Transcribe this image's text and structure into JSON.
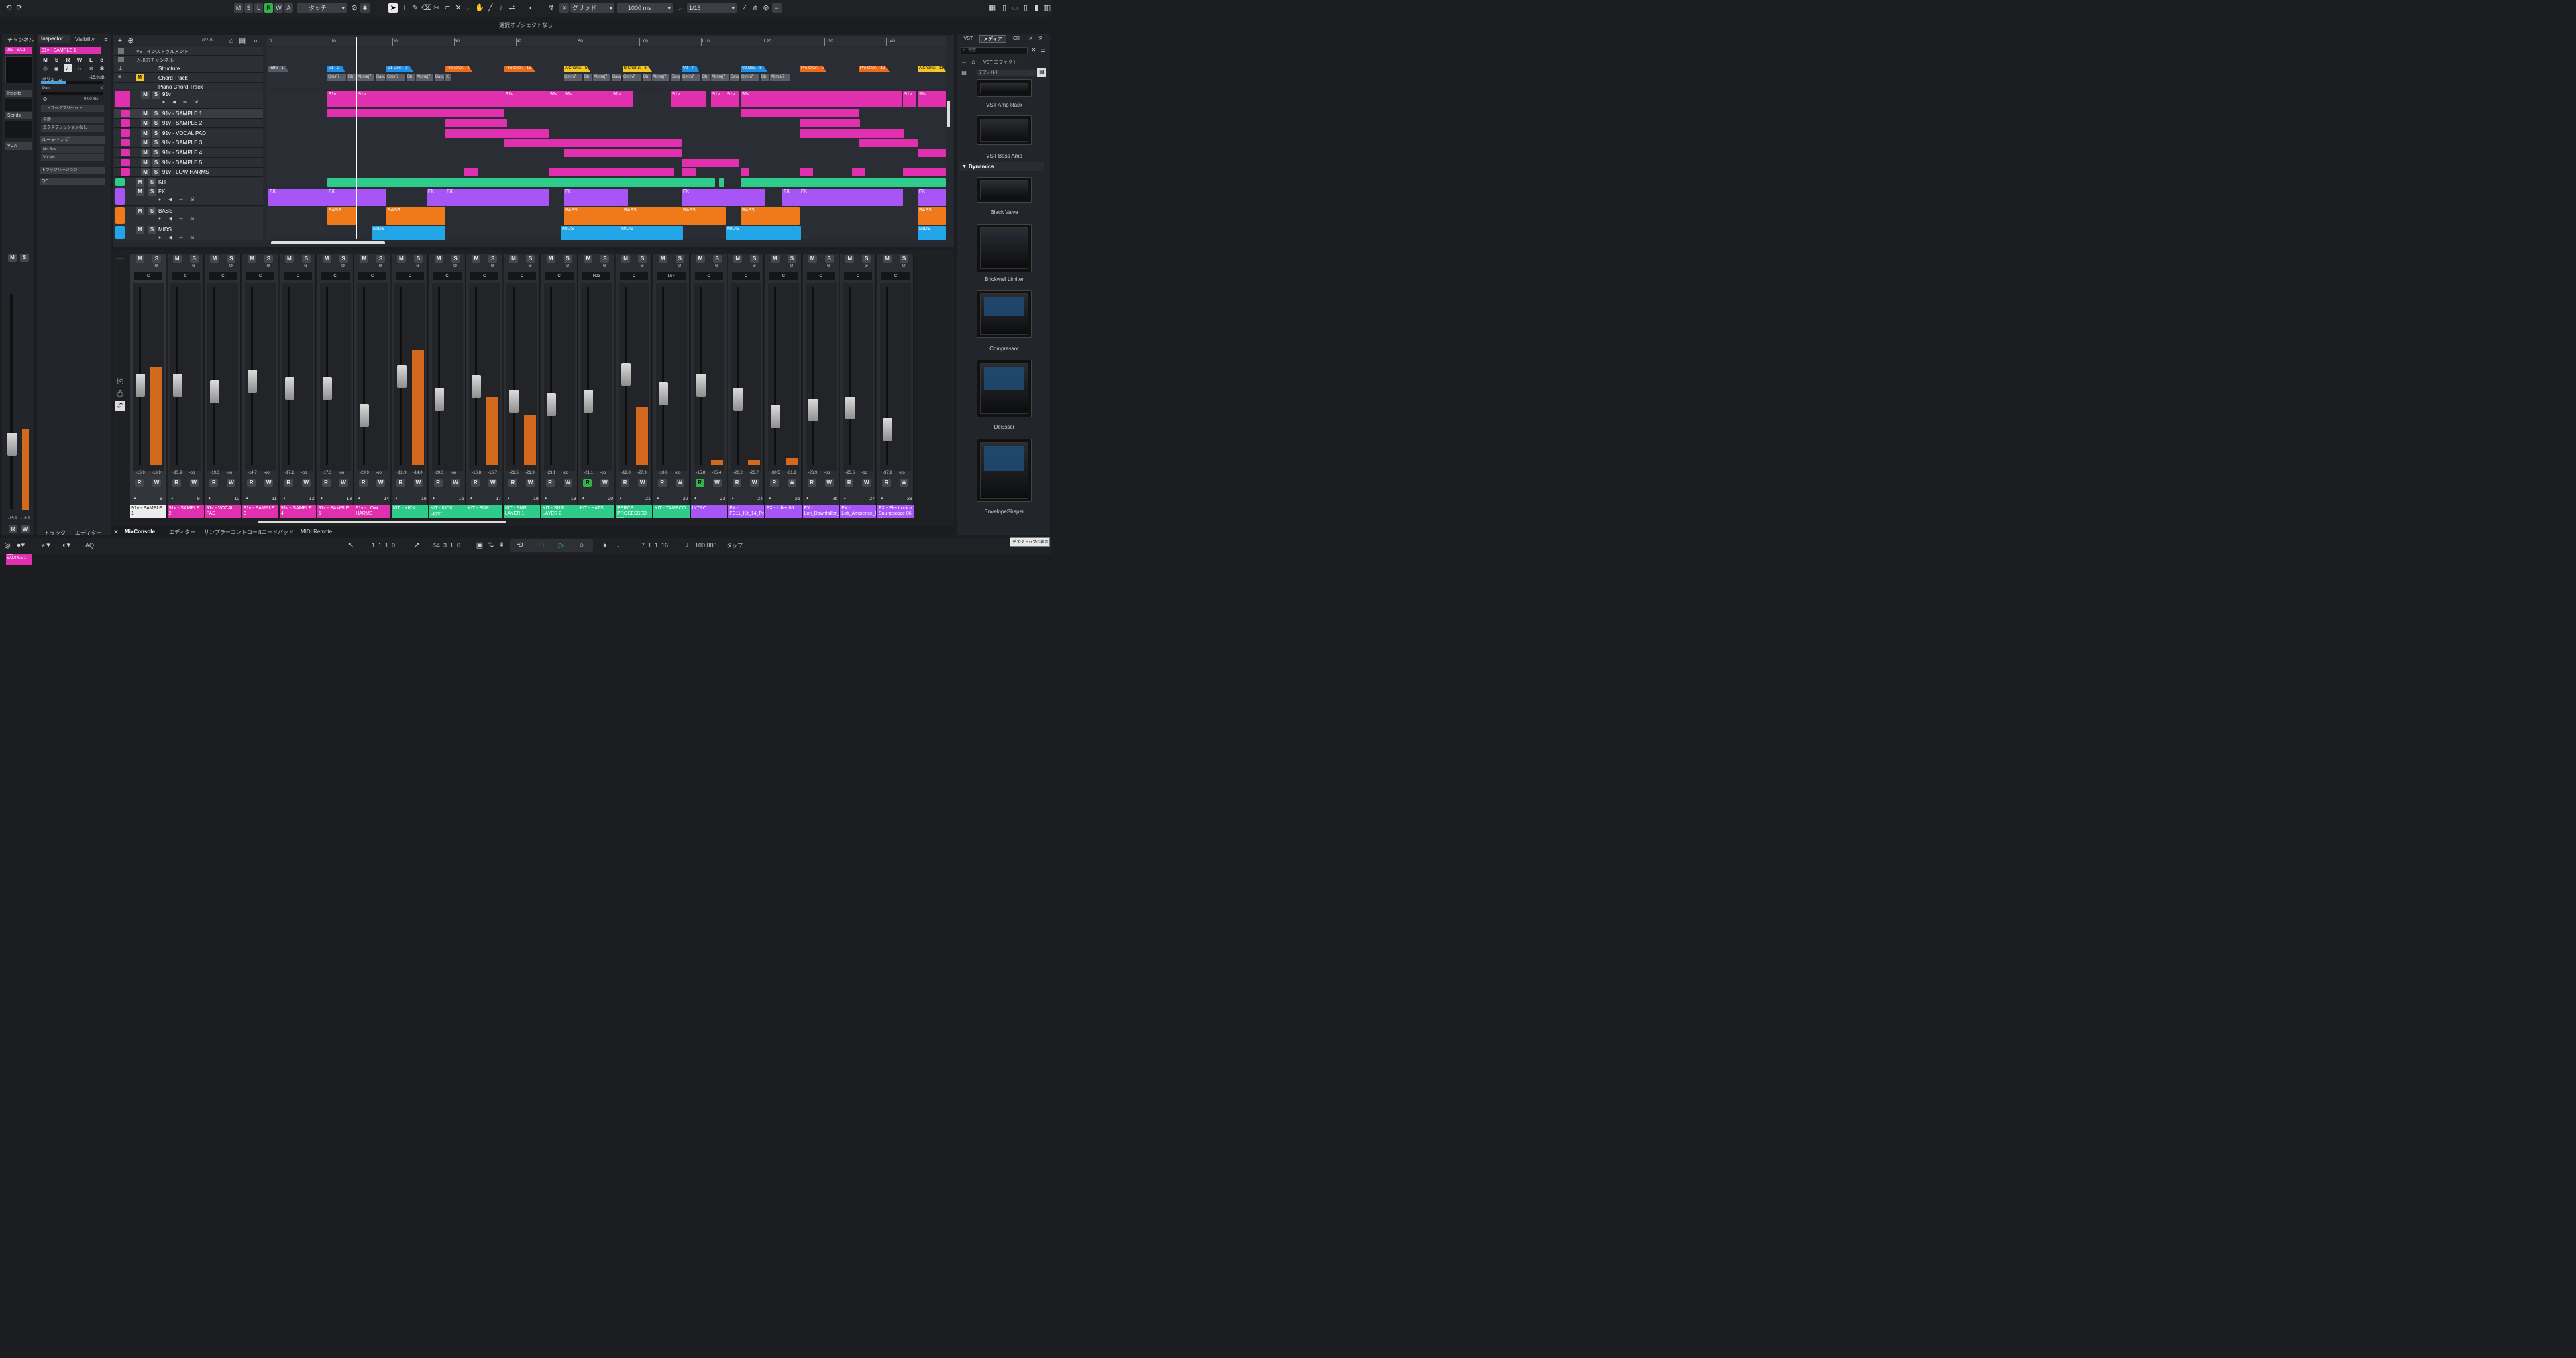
{
  "toolbar": {
    "ms_buttons": [
      "M",
      "S",
      "L",
      "R",
      "W",
      "A"
    ],
    "automation_mode": "タッチ",
    "snap_type": "グリッド",
    "time_value": "1000 ms",
    "quantize": "1/16",
    "status": "選択オブジェクトなし"
  },
  "left": {
    "channel_tab": "チャンネル",
    "channel_name": "91v - SA.1",
    "inspector_tab": "Inspector",
    "visibility_tab": "Visibility",
    "track_name": "91v - SAMPLE 1",
    "volume_label": "ボリューム",
    "volume_value": "-15.9 dB",
    "pan_label": "Pan",
    "pan_value": "C",
    "delay_value": "0.00 ms",
    "preset_placeholder": "トラックプリセット...",
    "dropdown1": "全般",
    "dropdown2": "エクスプレッションなし",
    "inserts": "Inserts",
    "sends": "Sends",
    "vca": "VCA",
    "routing": "ルーティング",
    "route_in": "No Bus",
    "route_out": "Vocals",
    "track_version": "トラックバージョン",
    "qc": "QC",
    "meter_l": "-15.9",
    "meter_r": "-16.9",
    "bottom_tab_track": "トラック",
    "bottom_tab_editor": "エディター",
    "strip_name": "91v - SAMPLE 1",
    "strip_num": "8"
  },
  "project": {
    "track_count": "70 / 70",
    "global_tracks": [
      "VST インストゥルメント",
      "入出力チャンネル",
      "Structure",
      "Chord Track",
      "Piano Chord Track"
    ],
    "tracks": [
      {
        "name": "91v",
        "color": "#e030b0"
      },
      {
        "name": "91v - SAMPLE 1",
        "color": "#e030b0"
      },
      {
        "name": "91v - SAMPLE 2",
        "color": "#e030b0"
      },
      {
        "name": "91v - VOCAL PAD",
        "color": "#e030b0"
      },
      {
        "name": "91v - SAMPLE 3",
        "color": "#e030b0"
      },
      {
        "name": "91v - SAMPLE 4",
        "color": "#e030b0"
      },
      {
        "name": "91v - SAMPLE 5",
        "color": "#e030b0"
      },
      {
        "name": "91v - LOW HARMS",
        "color": "#e030b0"
      },
      {
        "name": "KIT",
        "color": "#2ecc8a"
      },
      {
        "name": "FX",
        "color": "#a855f7"
      },
      {
        "name": "BASS",
        "color": "#f07a1a"
      },
      {
        "name": "MIDS",
        "color": "#22a6e8"
      }
    ],
    "ruler": [
      "10",
      "20",
      "30",
      "40",
      "50",
      "1:00",
      "1:10",
      "1:20",
      "1:30",
      "1:40"
    ],
    "markers": [
      "Intro - 1",
      "V1 - 2",
      "V1 Dev. - 3",
      "Pre Chor. - 4",
      "Pre Chor. - 15",
      "A Chorus - 5",
      "B Chorus - 6",
      "V2 - 7",
      "V2 Dev. - 8",
      "Pre Chor. - 9",
      "Pre Chor. - 10",
      "A Chorus - 11"
    ],
    "chords": [
      "Cmin7",
      "Bb",
      "Abmaj7",
      "Baug",
      "Cmin7",
      "Bb",
      "Abmaj7",
      "Baug",
      "X",
      "Cmin7",
      "Bb",
      "Abmaj7",
      "Baug",
      "Cmin7",
      "Bb",
      "Abmaj7",
      "Baug",
      "Cmin7",
      "Bb",
      "Abmaj7",
      "Baug",
      "Cmin7",
      "Bb",
      "Abmaj7"
    ],
    "clip_91v": "91v",
    "clip_fx": "FX",
    "clip_bass": "BASS",
    "clip_mids": "MIDS"
  },
  "mixer": {
    "channels": [
      {
        "num": "8",
        "name": "91v - SAMPLE 1",
        "l": "-15.9",
        "r": "-16.9",
        "pan": "C",
        "color": "#ececec",
        "text": "#111",
        "fader": 0.45,
        "meter": 0.55
      },
      {
        "num": "9",
        "name": "91v - SAMPLE 2",
        "l": "-15.9",
        "r": "-oo",
        "pan": "C",
        "color": "#e030b0",
        "text": "#fff",
        "fader": 0.45,
        "meter": 0
      },
      {
        "num": "10",
        "name": "91v - VOCAL PAD",
        "l": "-19.3",
        "r": "-oo",
        "pan": "C",
        "color": "#e030b0",
        "text": "#fff",
        "fader": 0.41,
        "meter": 0
      },
      {
        "num": "11",
        "name": "91v - SAMPLE 3",
        "l": "-14.7",
        "r": "-oo",
        "pan": "C",
        "color": "#e030b0",
        "text": "#fff",
        "fader": 0.47,
        "meter": 0
      },
      {
        "num": "12",
        "name": "91v - SAMPLE 4",
        "l": "-17.1",
        "r": "-oo",
        "pan": "C",
        "color": "#e030b0",
        "text": "#fff",
        "fader": 0.43,
        "meter": 0
      },
      {
        "num": "13",
        "name": "91v - SAMPLE 5",
        "l": "-17.3",
        "r": "-oo",
        "pan": "C",
        "color": "#e030b0",
        "text": "#fff",
        "fader": 0.43,
        "meter": 0
      },
      {
        "num": "14",
        "name": "91v - LOW HARMS",
        "l": "-29.9",
        "r": "-oo",
        "pan": "C",
        "color": "#e030b0",
        "text": "#fff",
        "fader": 0.28,
        "meter": 0
      },
      {
        "num": "15",
        "name": "KIT - KICK",
        "l": "-12.9",
        "r": "-14.0",
        "pan": "C",
        "color": "#2ecc8a",
        "text": "#fff",
        "fader": 0.5,
        "meter": 0.65
      },
      {
        "num": "16",
        "name": "KIT - KICK Layer",
        "l": "-20.3",
        "r": "-oo",
        "pan": "C",
        "color": "#2ecc8a",
        "text": "#fff",
        "fader": 0.37,
        "meter": 0
      },
      {
        "num": "17",
        "name": "KIT - SNR",
        "l": "-16.8",
        "r": "-16.7",
        "pan": "C",
        "color": "#2ecc8a",
        "text": "#fff",
        "fader": 0.44,
        "meter": 0.38
      },
      {
        "num": "18",
        "name": "KIT - SNR LAYER 1",
        "l": "-21.5",
        "r": "-21.9",
        "pan": "C",
        "color": "#2ecc8a",
        "text": "#fff",
        "fader": 0.36,
        "meter": 0.28
      },
      {
        "num": "19",
        "name": "KIT - SNR LAYER 2",
        "l": "-23.1",
        "r": "-oo",
        "pan": "C",
        "color": "#2ecc8a",
        "text": "#fff",
        "fader": 0.34,
        "meter": 0
      },
      {
        "num": "20",
        "name": "KIT - HATS",
        "l": "-21.1",
        "r": "-oo",
        "pan": "R23",
        "color": "#2ecc8a",
        "text": "#fff",
        "fader": 0.36,
        "meter": 0
      },
      {
        "num": "21",
        "name": "PERCS PROCESSED GRP",
        "l": "-12.0",
        "r": "-27.9",
        "pan": "C",
        "color": "#2ecc8a",
        "text": "#fff",
        "fader": 0.51,
        "meter": 0.33
      },
      {
        "num": "22",
        "name": "KIT - TAMBOO",
        "l": "-18.6",
        "r": "-oo",
        "pan": "L54",
        "color": "#2ecc8a",
        "text": "#fff",
        "fader": 0.4,
        "meter": 0
      },
      {
        "num": "23",
        "name": "INTRO",
        "l": "-15.8",
        "r": "-25.4",
        "pan": "C",
        "color": "#a855f7",
        "text": "#fff",
        "fader": 0.45,
        "meter": 0.03
      },
      {
        "num": "24",
        "name": "FX - FC11_Kit_14_Perc",
        "l": "-20.2",
        "r": "-23.7",
        "pan": "C",
        "color": "#a855f7",
        "text": "#fff",
        "fader": 0.37,
        "meter": 0.03
      },
      {
        "num": "25",
        "name": "FX - Lifter 05",
        "l": "-30.5",
        "r": "-31.8",
        "pan": "C",
        "color": "#a855f7",
        "text": "#fff",
        "fader": 0.27,
        "meter": 0.04
      },
      {
        "num": "26",
        "name": "FX - Lofi_Downfaller_0",
        "l": "-26.9",
        "r": "-oo",
        "pan": "C",
        "color": "#a855f7",
        "text": "#fff",
        "fader": 0.31,
        "meter": 0
      },
      {
        "num": "27",
        "name": "FX - Lofi_Ambience_0",
        "l": "-25.6",
        "r": "-oo",
        "pan": "C",
        "color": "#a855f7",
        "text": "#fff",
        "fader": 0.32,
        "meter": 0
      },
      {
        "num": "28",
        "name": "FX - Electronica Soundscape 06 D",
        "l": "-37.9",
        "r": "-oo",
        "pan": "C",
        "color": "#a855f7",
        "text": "#fff",
        "fader": 0.2,
        "meter": 0
      }
    ]
  },
  "bottom_tabs": [
    "MixConsole",
    "エディター",
    "サンプラーコントロール",
    "コードパッド",
    "MIDI Remote"
  ],
  "transport": {
    "left_locator": "1. 1. 1. 0",
    "right_locator": "54. 3. 1. 0",
    "position": "7. 1. 1. 16",
    "tempo": "100.000",
    "tap": "タップ",
    "aq": "AQ",
    "tooltip": "デスクトップの表示"
  },
  "right": {
    "tabs": [
      "VSTi",
      "メディア",
      "CR",
      "メーター"
    ],
    "search_placeholder": "検索",
    "breadcrumb": "VST エフェクト",
    "preset": "デフォルト",
    "category": "Dynamics",
    "plugins": [
      "VST Amp Rack",
      "VST Bass Amp",
      "Black Valve",
      "Brickwall Limiter",
      "Compressor",
      "DeEsser",
      "EnvelopeShaper"
    ]
  }
}
